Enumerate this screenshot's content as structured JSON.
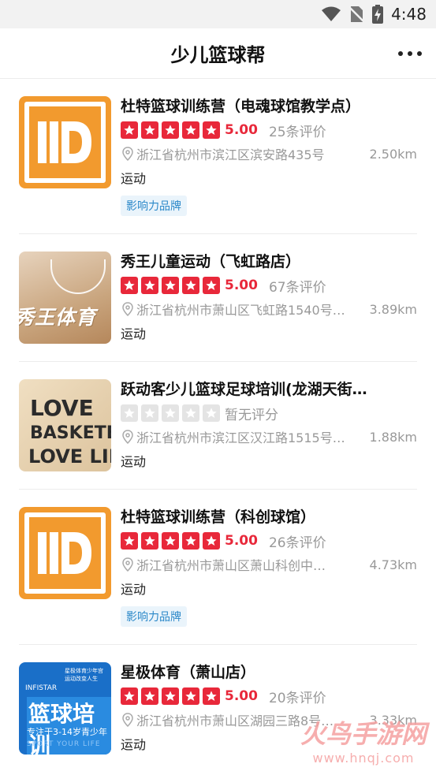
{
  "status": {
    "time": "4:48"
  },
  "header": {
    "title": "少儿篮球帮"
  },
  "items": [
    {
      "name": "杜特篮球训练营（电魂球馆教学点）",
      "score": "5.00",
      "reviews": "25条评价",
      "address": "浙江省杭州市滨江区滨安路435号",
      "distance": "2.50km",
      "category": "运动",
      "badge": "影响力品牌"
    },
    {
      "name": "秀王儿童运动（飞虹路店）",
      "score": "5.00",
      "reviews": "67条评价",
      "address": "浙江省杭州市萧山区飞虹路1540号…",
      "distance": "3.89km",
      "category": "运动",
      "thumb_text": "秀王体育"
    },
    {
      "name": "跃动客少儿篮球足球培训(龙湖天街…",
      "no_rating": "暂无评分",
      "address": "浙江省杭州市滨江区汉江路1515号…",
      "distance": "1.88km",
      "category": "运动",
      "thumb_lines": [
        "LOVE",
        "BASKETE",
        "LOVE LIFE"
      ]
    },
    {
      "name": "杜特篮球训练营（科创球馆）",
      "score": "5.00",
      "reviews": "26条评价",
      "address": "浙江省杭州市萧山区萧山科创中…",
      "distance": "4.73km",
      "category": "运动",
      "badge": "影响力品牌"
    },
    {
      "name": "星极体育（萧山店）",
      "score": "5.00",
      "reviews": "20条评价",
      "address": "浙江省杭州市萧山区湖园三路8号…",
      "distance": "3.33km",
      "category": "运动",
      "thumb": {
        "brand": "INFISTAR",
        "top": "星极体育少年宫",
        "top2": "运动改变人生",
        "big": "篮球培训",
        "sub": "专注于3-14岁青少年",
        "en": "SPORT YOUR LIFE"
      }
    }
  ],
  "watermark": {
    "line1": "火鸟手游网",
    "line2": "www.hnqj.com"
  },
  "colors": {
    "accent": "#e8283a",
    "badge": "#2b88c9",
    "brand_orange": "#f29a2e"
  }
}
